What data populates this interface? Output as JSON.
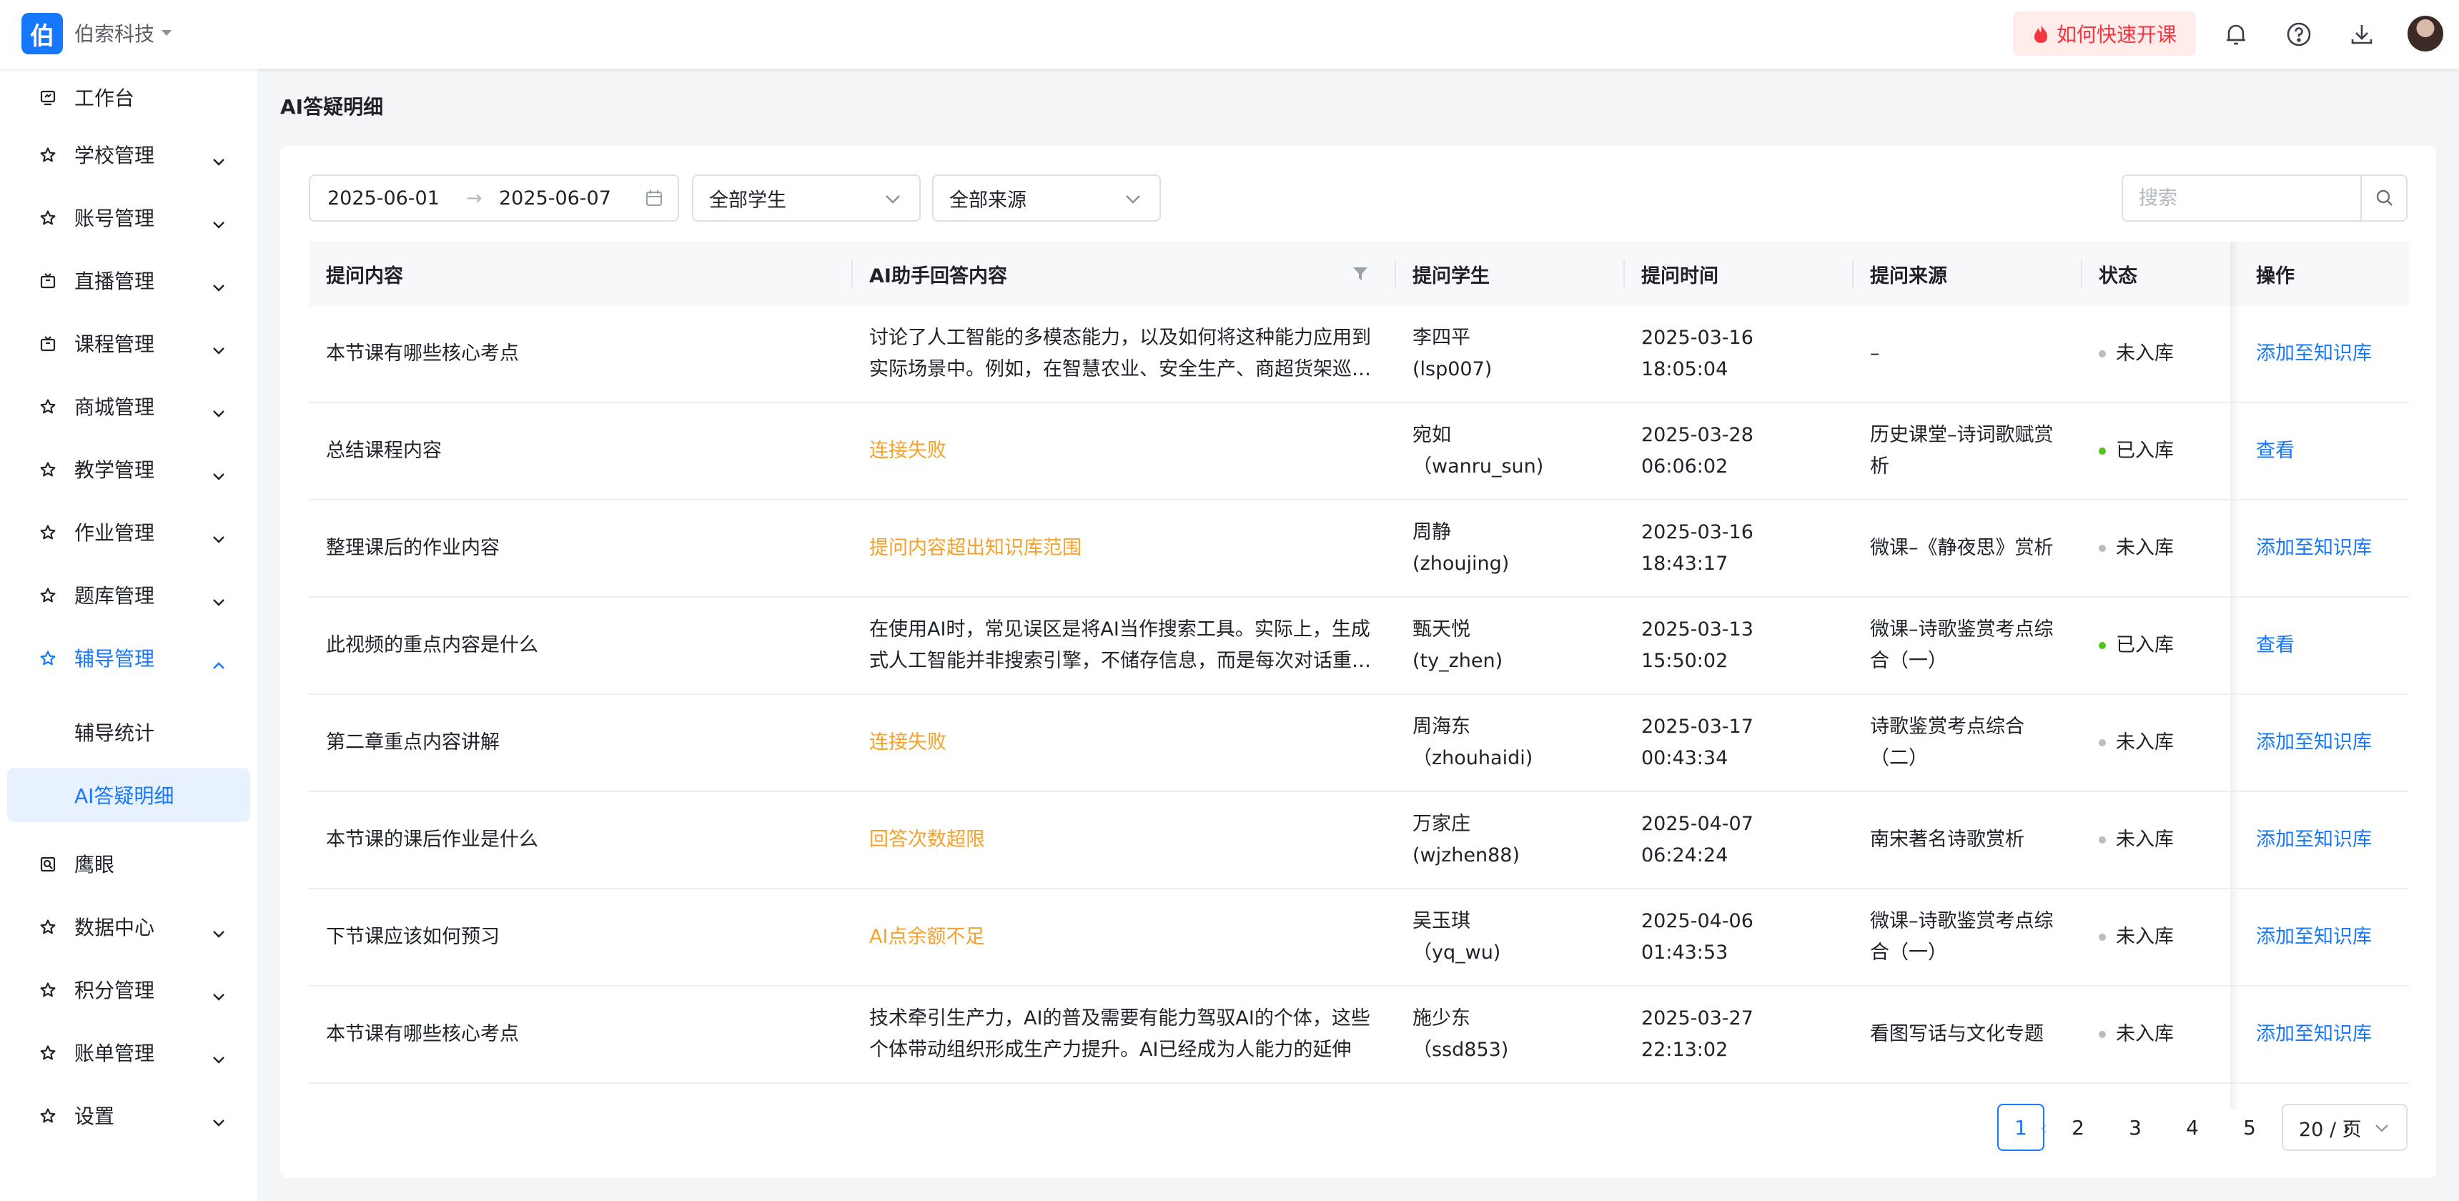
{
  "header": {
    "logo_char": "伯",
    "org_name": "伯索科技",
    "quick_start_label": "如何快速开课",
    "icons": [
      "bell-icon",
      "help-icon",
      "download-icon",
      "avatar"
    ]
  },
  "sidebar": {
    "items": [
      {
        "label": "工作台",
        "icon": "monitor-icon",
        "expandable": false
      },
      {
        "label": "学校管理",
        "icon": "star-icon",
        "expandable": true
      },
      {
        "label": "账号管理",
        "icon": "star-icon",
        "expandable": true
      },
      {
        "label": "直播管理",
        "icon": "live-icon",
        "expandable": true
      },
      {
        "label": "课程管理",
        "icon": "live-icon",
        "expandable": true
      },
      {
        "label": "商城管理",
        "icon": "star-icon",
        "expandable": true
      },
      {
        "label": "教学管理",
        "icon": "star-icon",
        "expandable": true
      },
      {
        "label": "作业管理",
        "icon": "star-icon",
        "expandable": true
      },
      {
        "label": "题库管理",
        "icon": "star-icon",
        "expandable": true
      },
      {
        "label": "辅导管理",
        "icon": "star-icon",
        "expandable": true,
        "expanded": true
      },
      {
        "label": "鹰眼",
        "icon": "eye-icon",
        "expandable": false
      },
      {
        "label": "数据中心",
        "icon": "star-icon",
        "expandable": true
      },
      {
        "label": "积分管理",
        "icon": "star-icon",
        "expandable": true
      },
      {
        "label": "账单管理",
        "icon": "star-icon",
        "expandable": true
      },
      {
        "label": "设置",
        "icon": "star-icon",
        "expandable": true
      }
    ],
    "sub_items": [
      {
        "label": "辅导统计",
        "selected": false
      },
      {
        "label": "AI答疑明细",
        "selected": true
      }
    ]
  },
  "page": {
    "title": "AI答疑明细"
  },
  "filters": {
    "date_start": "2025-06-01",
    "date_arrow": "→",
    "date_end": "2025-06-07",
    "student_select": "全部学生",
    "source_select": "全部来源",
    "search_placeholder": "搜索"
  },
  "table": {
    "columns": [
      "提问内容",
      "AI助手回答内容",
      "提问学生",
      "提问时间",
      "提问来源",
      "状态",
      "操作"
    ],
    "rows": [
      {
        "question": "本节课有哪些核心考点",
        "answer": "讨论了人工智能的多模态能力，以及如何将这种能力应用到实际场景中。例如，在智慧农业、安全生产、商超货架巡检等领域",
        "answer_warn": false,
        "student": "李四平",
        "student_id": "(lsp007)",
        "date": "2025-03-16",
        "time": "18:05:04",
        "source": "–",
        "status": "未入库",
        "in_library": false,
        "action": "添加至知识库"
      },
      {
        "question": "总结课程内容",
        "answer": "连接失败",
        "answer_warn": true,
        "student": "宛如",
        "student_id": "（wanru_sun)",
        "date": "2025-03-28",
        "time": "06:06:02",
        "source": "历史课堂–诗词歌赋赏析",
        "status": "已入库",
        "in_library": true,
        "action": "查看"
      },
      {
        "question": "整理课后的作业内容",
        "answer": "提问内容超出知识库范围",
        "answer_warn": true,
        "student": "周静",
        "student_id": "(zhoujing)",
        "date": "2025-03-16",
        "time": "18:43:17",
        "source": "微课–《静夜思》赏析",
        "status": "未入库",
        "in_library": false,
        "action": "添加至知识库"
      },
      {
        "question": "此视频的重点内容是什么",
        "answer": "在使用AI时，常见误区是将AI当作搜索工具。实际上，生成式人工智能并非搜索引擎，不储存信息，而是每次对话重新生成内容",
        "answer_warn": false,
        "student": "甄天悦",
        "student_id": "(ty_zhen)",
        "date": "2025-03-13",
        "time": "15:50:02",
        "source": "微课–诗歌鉴赏考点综合（一）",
        "status": "已入库",
        "in_library": true,
        "action": "查看"
      },
      {
        "question": "第二章重点内容讲解",
        "answer": "连接失败",
        "answer_warn": true,
        "student": "周海东",
        "student_id": "（zhouhaidi)",
        "date": "2025-03-17",
        "time": "00:43:34",
        "source": "诗歌鉴赏考点综合（二）",
        "status": "未入库",
        "in_library": false,
        "action": "添加至知识库"
      },
      {
        "question": "本节课的课后作业是什么",
        "answer": "回答次数超限",
        "answer_warn": true,
        "student": "万家庄",
        "student_id": "(wjzhen88)",
        "date": "2025-04-07",
        "time": "06:24:24",
        "source": "南宋著名诗歌赏析",
        "status": "未入库",
        "in_library": false,
        "action": "添加至知识库"
      },
      {
        "question": "下节课应该如何预习",
        "answer": "AI点余额不足",
        "answer_warn": true,
        "student": "吴玉琪",
        "student_id": "（yq_wu)",
        "date": "2025-04-06",
        "time": "01:43:53",
        "source": "微课–诗歌鉴赏考点综合（一）",
        "status": "未入库",
        "in_library": false,
        "action": "添加至知识库"
      },
      {
        "question": "本节课有哪些核心考点",
        "answer": "技术牵引生产力，AI的普及需要有能力驾驭AI的个体，这些个体带动组织形成生产力提升。AI已经成为人能力的延伸",
        "answer_warn": false,
        "student": "施少东",
        "student_id": "（ssd853)",
        "date": "2025-03-27",
        "time": "22:13:02",
        "source": "看图写话与文化专题",
        "status": "未入库",
        "in_library": false,
        "action": "添加至知识库"
      }
    ]
  },
  "pagination": {
    "pages": [
      "1",
      "2",
      "3",
      "4",
      "5"
    ],
    "current": "1",
    "prev": "‹",
    "next": "›",
    "page_size": "20 / 页"
  },
  "colors": {
    "primary": "#1677ff",
    "warning": "#f7a12a",
    "in_library_dot": "#52c41a",
    "not_in_library_dot": "#b8bcc3",
    "quick_start_bg": "#ffeceb",
    "quick_start_text": "#f5363f"
  }
}
